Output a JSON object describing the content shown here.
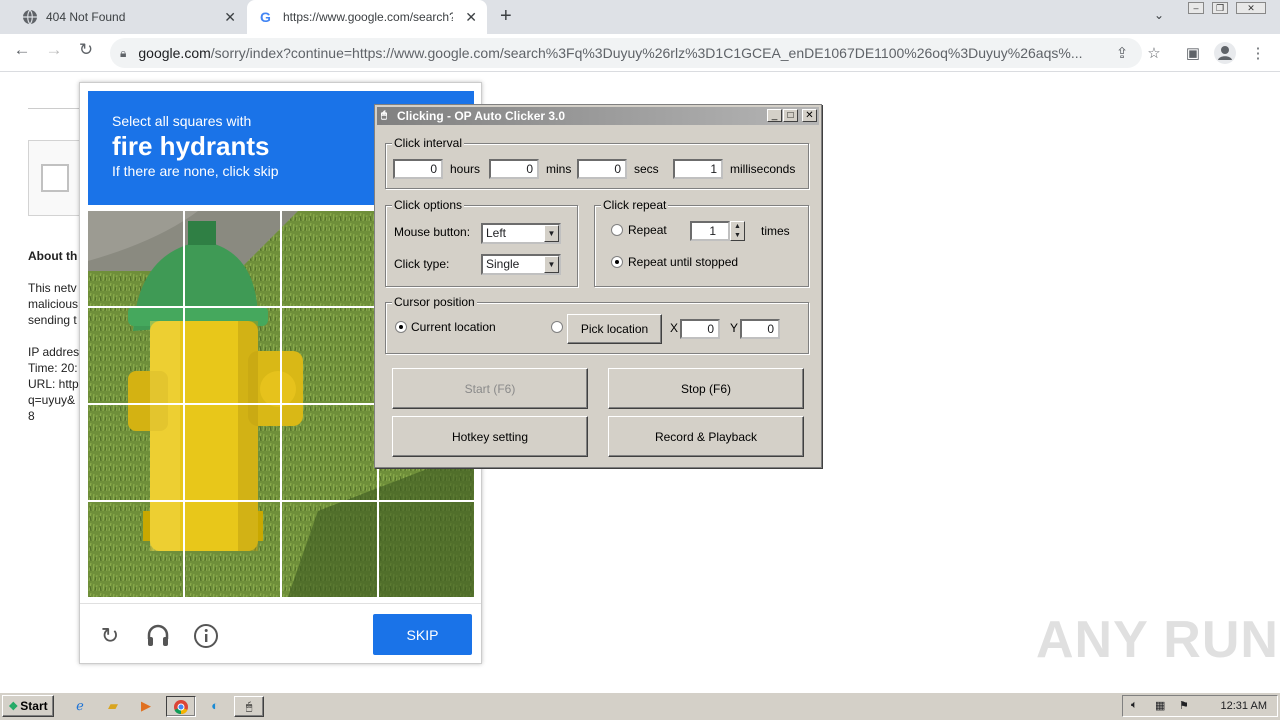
{
  "browser": {
    "tabs": [
      {
        "title": "404 Not Found"
      },
      {
        "title": "https://www.google.com/search?q="
      }
    ],
    "url_host": "google.com",
    "url_rest": "/sorry/index?continue=https://www.google.com/search%3Fq%3Duyuy%26rlz%3D1C1GCEA_enDE1067DE1100%26oq%3Duyuy%26aqs%..."
  },
  "page": {
    "lines": [
      "About th",
      "This netv",
      "malicious",
      "sending t",
      "IP addres",
      "Time: 20:",
      "URL: http",
      "q=uyuy&",
      "8"
    ]
  },
  "captcha": {
    "line1": "Select all squares with",
    "line2": "fire hydrants",
    "line3": "If there are none, click skip",
    "skip_label": "SKIP"
  },
  "clicker": {
    "title": "Clicking - OP Auto Clicker 3.0",
    "interval": {
      "group": "Click interval",
      "hours": "0",
      "hours_label": "hours",
      "mins": "0",
      "mins_label": "mins",
      "secs": "0",
      "secs_label": "secs",
      "ms": "1",
      "ms_label": "milliseconds"
    },
    "options": {
      "group": "Click options",
      "mouse_label": "Mouse button:",
      "mouse_value": "Left",
      "type_label": "Click type:",
      "type_value": "Single"
    },
    "repeat": {
      "group": "Click repeat",
      "repeat_label": "Repeat",
      "repeat_value": "1",
      "times_label": "times",
      "until_label": "Repeat until stopped"
    },
    "cursor": {
      "group": "Cursor position",
      "current_label": "Current location",
      "pick_label": "Pick location",
      "x_label": "X",
      "x_value": "0",
      "y_label": "Y",
      "y_value": "0"
    },
    "buttons": {
      "start": "Start (F6)",
      "stop": "Stop (F6)",
      "hotkey": "Hotkey setting",
      "record": "Record & Playback"
    }
  },
  "taskbar": {
    "start_label": "Start",
    "clock": "12:31 AM"
  },
  "watermark": "ANY RUN"
}
